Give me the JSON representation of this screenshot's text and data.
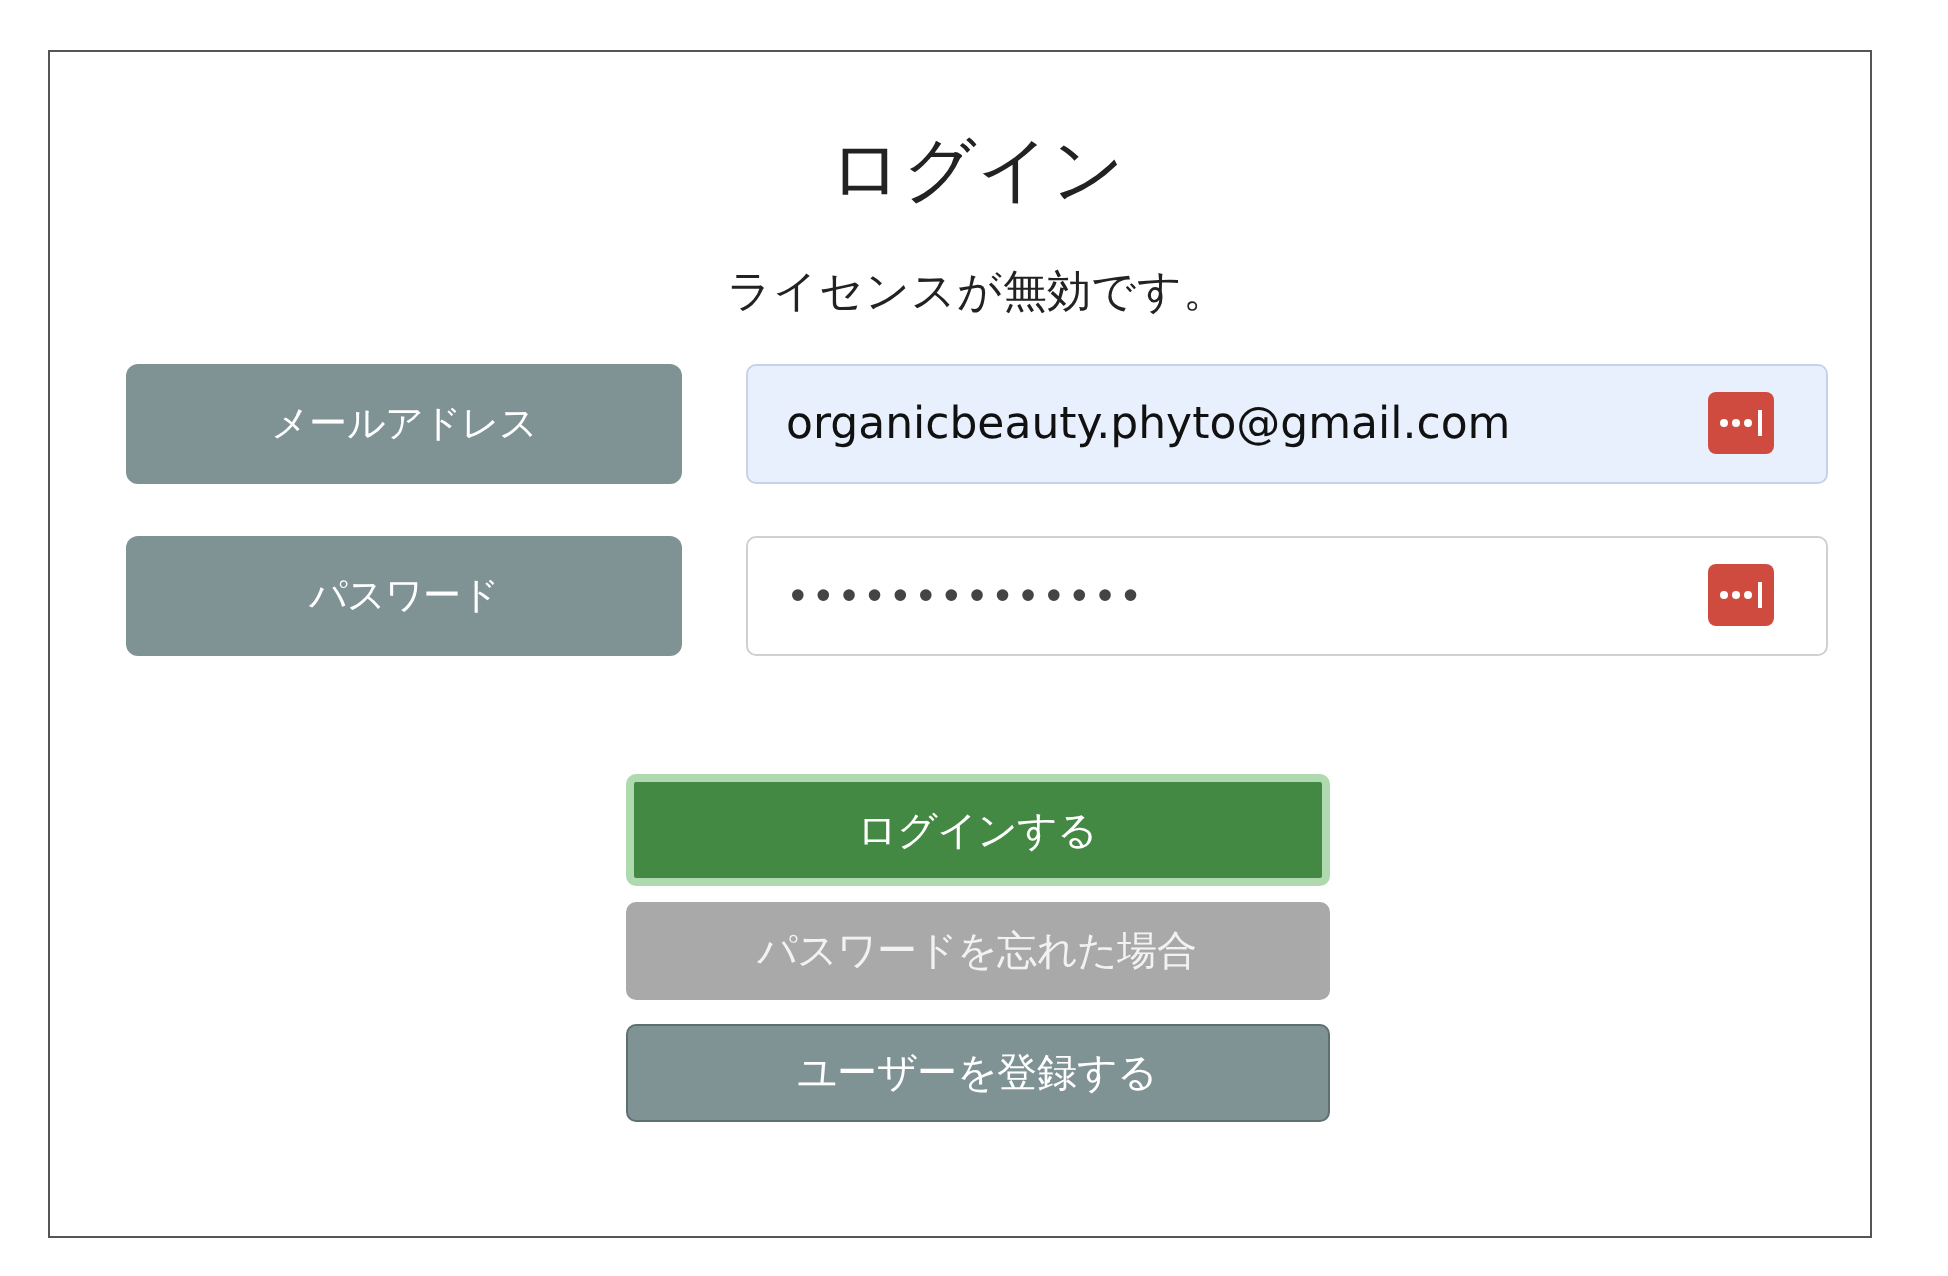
{
  "title": "ログイン",
  "message": "ライセンスが無効です。",
  "fields": [
    {
      "label": "メールアドレス",
      "value": "organicbeauty.phyto@gmail.com",
      "autofilled": true,
      "kind": "text"
    },
    {
      "label": "パスワード",
      "value": "••••••••••••••",
      "autofilled": false,
      "kind": "password"
    }
  ],
  "buttons": [
    {
      "label": "ログインする",
      "kind": "primary",
      "focused": true,
      "disabled": false
    },
    {
      "label": "パスワードを忘れた場合",
      "kind": "secondary",
      "focused": false,
      "disabled": true
    },
    {
      "label": "ユーザーを登録する",
      "kind": "secondary",
      "focused": false,
      "disabled": false
    }
  ]
}
